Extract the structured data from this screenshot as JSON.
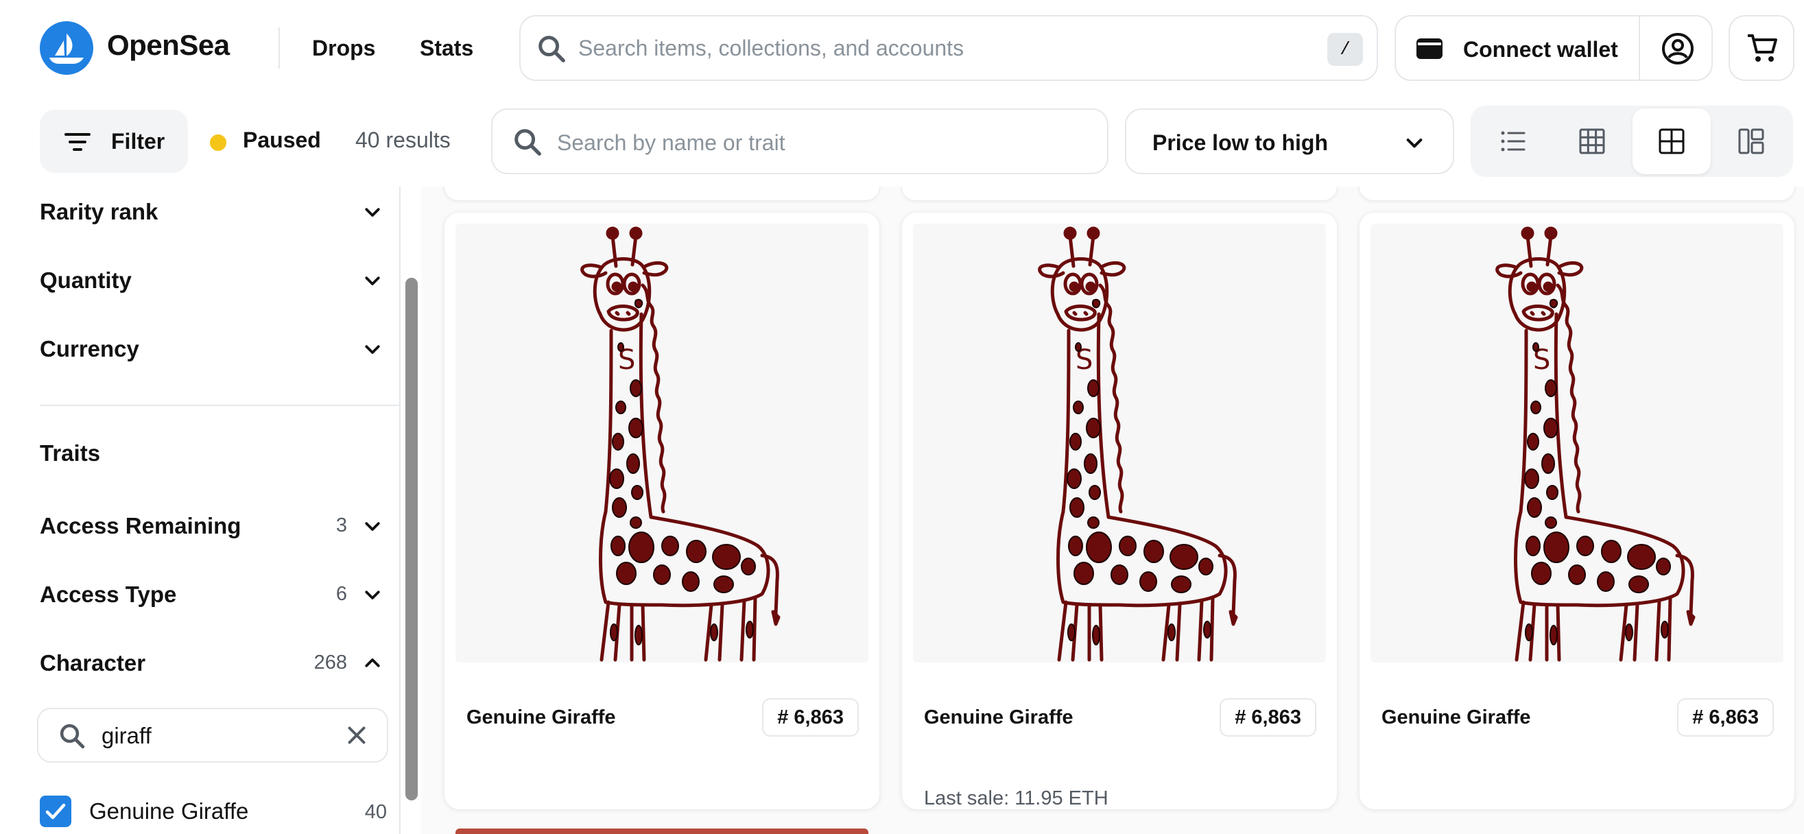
{
  "nav": {
    "brand": "OpenSea",
    "links": [
      "Drops",
      "Stats"
    ],
    "search_placeholder": "Search items, collections, and accounts",
    "search_shortcut": "/",
    "connect_wallet": "Connect wallet"
  },
  "toolbar": {
    "filter_label": "Filter",
    "status": "Paused",
    "status_color": "#f5c518",
    "results": "40 results",
    "trait_search_placeholder": "Search by name or trait",
    "sort_value": "Price low to high",
    "view_modes": [
      "list-view-icon",
      "small-grid-icon",
      "large-grid-icon",
      "masonry-view-icon"
    ],
    "active_view": "large-grid-icon"
  },
  "sidebar": {
    "filters": [
      {
        "label": "Rarity rank",
        "expanded": false
      },
      {
        "label": "Quantity",
        "expanded": false
      },
      {
        "label": "Currency",
        "expanded": false
      }
    ],
    "traits_heading": "Traits",
    "traits": [
      {
        "label": "Access Remaining",
        "count": "3",
        "expanded": false
      },
      {
        "label": "Access Type",
        "count": "6",
        "expanded": false
      },
      {
        "label": "Character",
        "count": "268",
        "expanded": true
      }
    ],
    "character_search_value": "giraff",
    "options": [
      {
        "label": "Genuine Giraffe",
        "count": "40",
        "checked": true
      }
    ]
  },
  "items": [
    {
      "name": "Genuine Giraffe",
      "number": "# 6,863",
      "last_sale": ""
    },
    {
      "name": "Genuine Giraffe",
      "number": "# 6,863",
      "last_sale": "Last sale: 11.95 ETH"
    },
    {
      "name": "Genuine Giraffe",
      "number": "# 6,863",
      "last_sale": ""
    }
  ],
  "colors": {
    "brand": "#2081e2",
    "border": "#e5e8eb",
    "giraffe_line": "#6b0c0c"
  }
}
